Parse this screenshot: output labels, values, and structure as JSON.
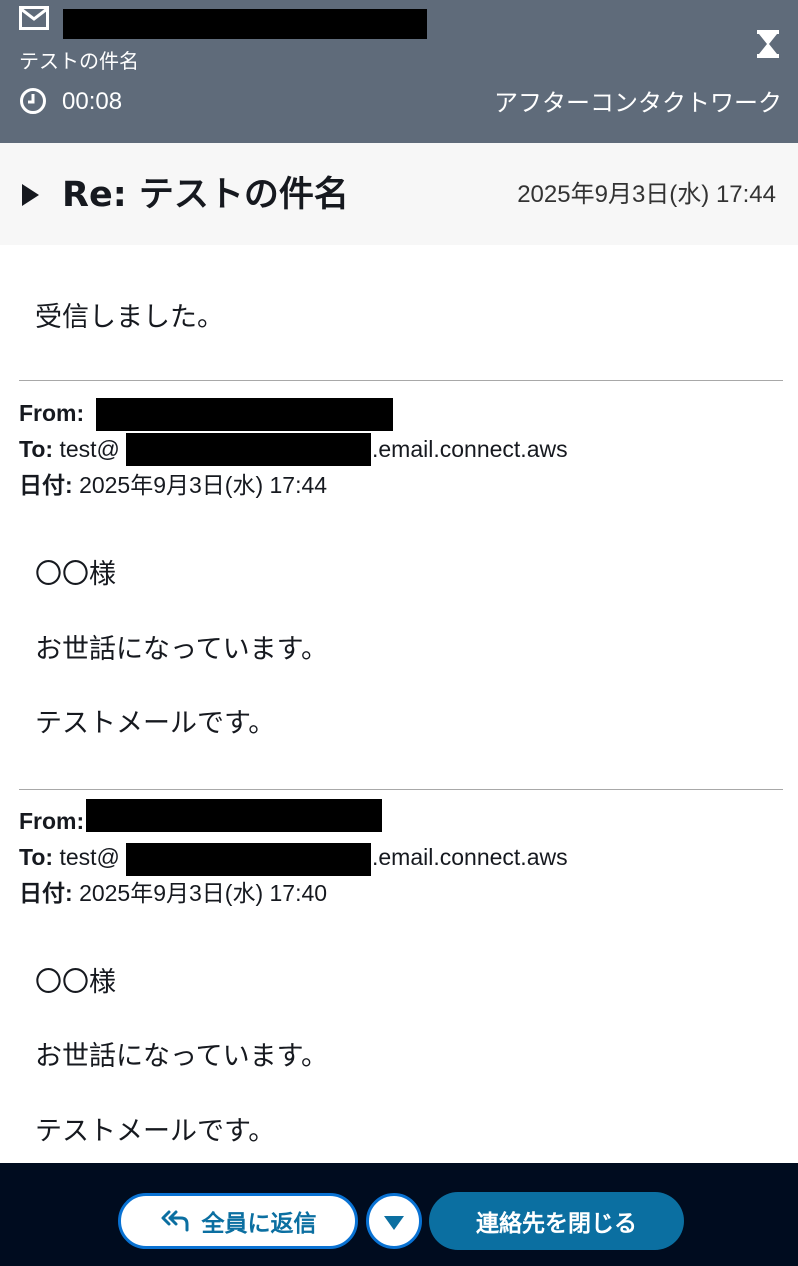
{
  "header": {
    "mail_icon": "envelope-icon",
    "subject": "テストの件名",
    "clock_icon": "clock-icon",
    "timer": "00:08",
    "hourglass_icon": "hourglass-icon",
    "status": "アフターコンタクトワーク",
    "background": "#5f6b7a"
  },
  "thread": {
    "toggle_icon": "expand-triangle-icon",
    "subject": "Re: テストの件名",
    "date": "2025年9月3日(水) 17:44"
  },
  "messages": [
    {
      "body": [
        "受信しました。"
      ]
    },
    {
      "from_label": "From:",
      "to_label": "To:",
      "to_prefix": "test@",
      "to_suffix": ".email.connect.aws",
      "date_label": "日付:",
      "date_value": "2025年9月3日(水) 17:44",
      "body": [
        "〇〇様",
        "お世話になっています。",
        "テストメールです。"
      ]
    },
    {
      "from_label": "From:",
      "to_label": "To:",
      "to_prefix": "test@",
      "to_suffix": ".email.connect.aws",
      "date_label": "日付:",
      "date_value": "2025年9月3日(水) 17:40",
      "body": [
        "〇〇様",
        "お世話になっています。",
        "テストメールです。"
      ]
    }
  ],
  "footer": {
    "reply_all_label": "全員に返信",
    "reply_all_icon": "reply-all-icon",
    "dropdown_icon": "chevron-down-icon",
    "close_contact_label": "連絡先を閉じる",
    "accent": "#0b6fa1",
    "background": "#000c1f"
  }
}
